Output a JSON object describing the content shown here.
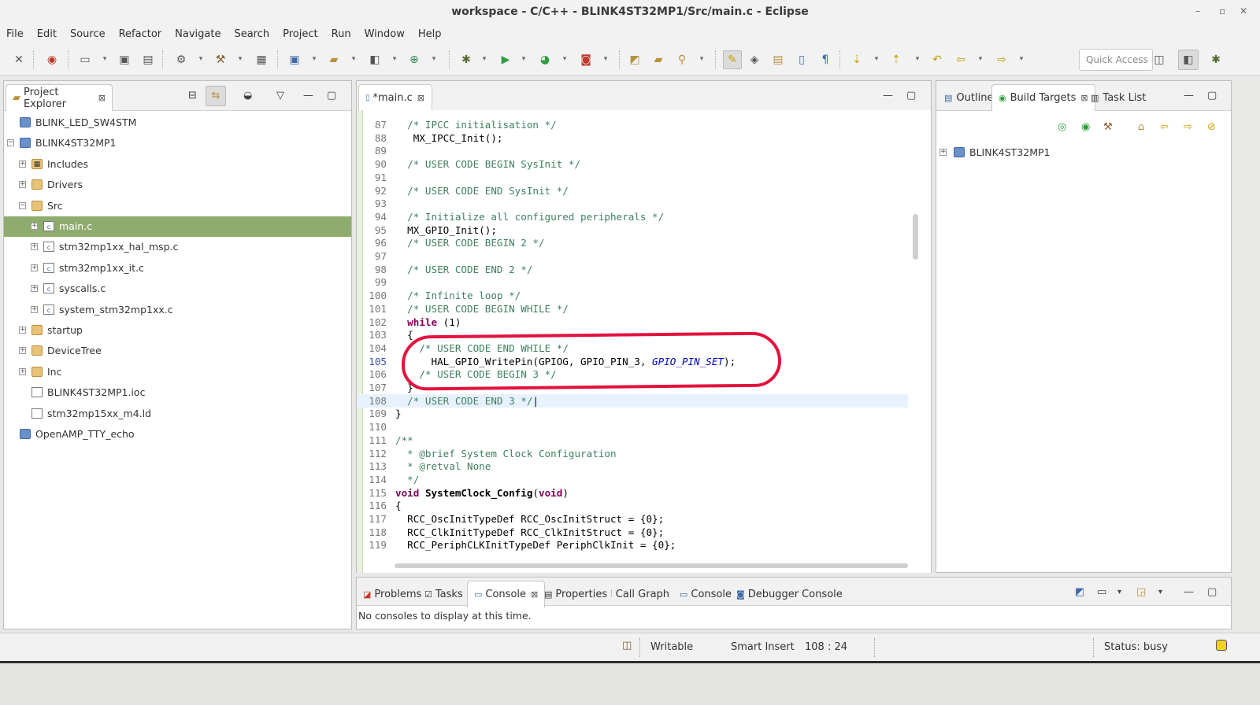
{
  "window": {
    "title": "workspace - C/C++ - BLINK4ST32MP1/Src/main.c - Eclipse",
    "minimize": "–",
    "restore": "▫",
    "close": "✕"
  },
  "menu": [
    "File",
    "Edit",
    "Source",
    "Refactor",
    "Navigate",
    "Search",
    "Project",
    "Run",
    "Window",
    "Help"
  ],
  "toolbar": {
    "quick_access_placeholder": "Quick Access"
  },
  "project_explorer": {
    "title": "Project Explorer",
    "items": [
      {
        "label": "BLINK_LED_SW4STM",
        "icon": "project-icon"
      },
      {
        "label": "BLINK4ST32MP1",
        "icon": "project-icon",
        "expander": "−"
      },
      {
        "label": "Includes",
        "icon": "includes-icon",
        "expander": "+"
      },
      {
        "label": "Drivers",
        "icon": "folder-icon",
        "expander": "+"
      },
      {
        "label": "Src",
        "icon": "folder-icon",
        "expander": "−"
      },
      {
        "label": "main.c",
        "icon": "c-file-icon",
        "expander": "+",
        "selected": true
      },
      {
        "label": "stm32mp1xx_hal_msp.c",
        "icon": "c-file-icon",
        "expander": "+"
      },
      {
        "label": "stm32mp1xx_it.c",
        "icon": "c-file-icon",
        "expander": "+"
      },
      {
        "label": "syscalls.c",
        "icon": "c-file-icon",
        "expander": "+"
      },
      {
        "label": "system_stm32mp1xx.c",
        "icon": "c-file-icon",
        "expander": "+"
      },
      {
        "label": "startup",
        "icon": "folder-icon",
        "expander": "+"
      },
      {
        "label": "DeviceTree",
        "icon": "folder-icon",
        "expander": "+"
      },
      {
        "label": "Inc",
        "icon": "folder-icon",
        "expander": "+"
      },
      {
        "label": "BLINK4ST32MP1.ioc",
        "icon": "ioc-file-icon"
      },
      {
        "label": "stm32mp15xx_m4.ld",
        "icon": "ld-file-icon"
      },
      {
        "label": "OpenAMP_TTY_echo",
        "icon": "project-icon"
      }
    ]
  },
  "editor": {
    "tab_label": "*main.c",
    "lines": [
      {
        "n": "87",
        "html": "  <span class=\"cm\">/* IPCC initialisation */</span>"
      },
      {
        "n": "88",
        "html": "   MX_IPCC_Init();"
      },
      {
        "n": "89",
        "html": ""
      },
      {
        "n": "90",
        "html": "  <span class=\"cm\">/* USER CODE BEGIN SysInit */</span>"
      },
      {
        "n": "91",
        "html": ""
      },
      {
        "n": "92",
        "html": "  <span class=\"cm\">/* USER CODE END SysInit */</span>"
      },
      {
        "n": "93",
        "html": ""
      },
      {
        "n": "94",
        "html": "  <span class=\"cm\">/* Initialize all configured peripherals */</span>"
      },
      {
        "n": "95",
        "html": "  MX_GPIO_Init();"
      },
      {
        "n": "96",
        "html": "  <span class=\"cm\">/* USER CODE BEGIN 2 */</span>"
      },
      {
        "n": "97",
        "html": ""
      },
      {
        "n": "98",
        "html": "  <span class=\"cm\">/* USER CODE END 2 */</span>"
      },
      {
        "n": "99",
        "html": ""
      },
      {
        "n": "100",
        "html": "  <span class=\"cm\">/* Infinite loop */</span>"
      },
      {
        "n": "101",
        "html": "  <span class=\"cm\">/* USER CODE BEGIN WHILE */</span>"
      },
      {
        "n": "102",
        "html": "  <span class=\"kw\">while</span> (1)"
      },
      {
        "n": "103",
        "html": "  {"
      },
      {
        "n": "104",
        "html": "    <span class=\"cm\">/* USER CODE END WHILE */</span>"
      },
      {
        "n": "105",
        "html": "      HAL_GPIO_WritePin(GPIOG, GPIO_PIN_3, <span class=\"mac\">GPIO_PIN_SET</span>);"
      },
      {
        "n": "106",
        "html": "    <span class=\"cm\">/* USER CODE BEGIN 3 */</span>"
      },
      {
        "n": "107",
        "html": "  }"
      },
      {
        "n": "108",
        "html": "  <span class=\"cm\">/* USER CODE END 3 */</span>|",
        "current": true
      },
      {
        "n": "109",
        "html": "}"
      },
      {
        "n": "110",
        "html": ""
      },
      {
        "n": "111",
        "html": "<span class=\"cm\">/**</span>"
      },
      {
        "n": "112",
        "html": "<span class=\"cm\">  * @brief System Clock Configuration</span>"
      },
      {
        "n": "113",
        "html": "<span class=\"cm\">  * @retval None</span>"
      },
      {
        "n": "114",
        "html": "<span class=\"cm\">  */</span>"
      },
      {
        "n": "115",
        "html": "<span class=\"kw\">void</span> <b>SystemClock_Config</b>(<span class=\"kw\">void</span>)"
      },
      {
        "n": "116",
        "html": "{"
      },
      {
        "n": "117",
        "html": "  RCC_OscInitTypeDef RCC_OscInitStruct = {0};"
      },
      {
        "n": "118",
        "html": "  RCC_ClkInitTypeDef RCC_ClkInitStruct = {0};"
      },
      {
        "n": "119",
        "html": "  RCC_PeriphCLKInitTypeDef PeriphClkInit = {0};"
      }
    ]
  },
  "right_panel": {
    "tabs": [
      "Outline",
      "Build Targets",
      "Task List"
    ],
    "active_tab": "Build Targets",
    "tree_item": "BLINK4ST32MP1"
  },
  "bottom_panel": {
    "tabs": [
      "Problems",
      "Tasks",
      "Console",
      "Properties",
      "Call Graph",
      "Console",
      "Debugger Console"
    ],
    "active_tab_index": 2,
    "message": "No consoles to display at this time."
  },
  "status": {
    "writable": "Writable",
    "insert_mode": "Smart Insert",
    "position": "108 : 24",
    "busy": "Status: busy"
  },
  "colors": {
    "selection": "#8fac6f",
    "annotation": "#e3123f",
    "comment": "#3f7f5f",
    "keyword": "#7f0055"
  }
}
